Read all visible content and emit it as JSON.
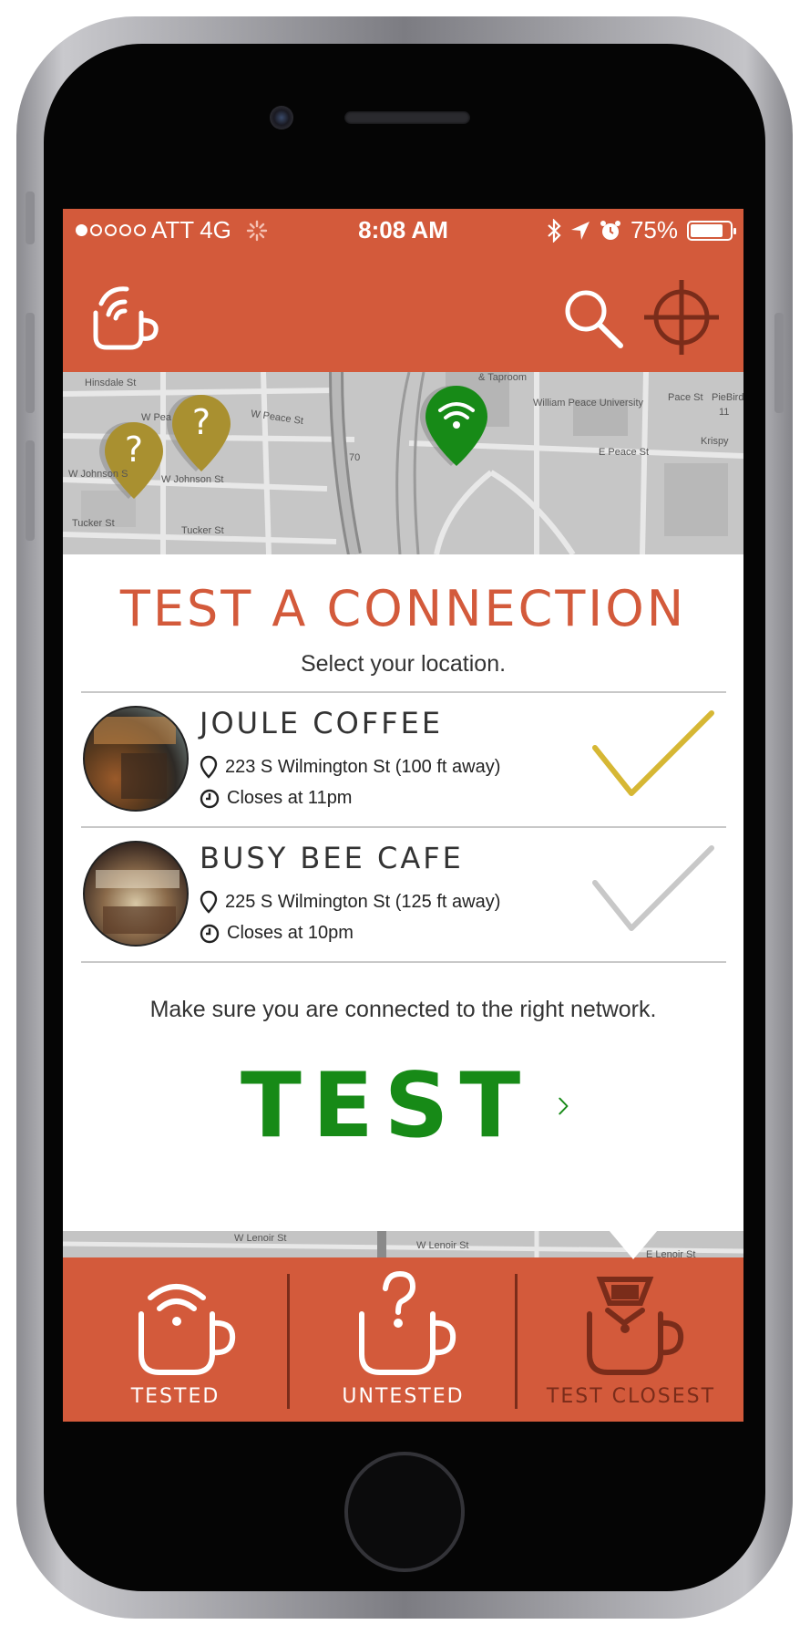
{
  "status_bar": {
    "signal_dots_filled": 1,
    "signal_dots_total": 5,
    "carrier": "ATT",
    "network": "4G",
    "time": "8:08 AM",
    "battery_percent": "75%",
    "battery_level": 0.75
  },
  "nav_bar": {
    "logo_icon": "wifi-coffee-cup-icon",
    "search_icon": "search-icon",
    "locate_icon": "crosshair-icon"
  },
  "map": {
    "labels": [
      "Hinsdale St",
      "W Peace St",
      "W Pea",
      "W Johnson St",
      "W Johnson S",
      "Tucker St",
      "Tucker St",
      "& Taproom",
      "William Peace University",
      "Pace St",
      "PieBird",
      "E Peace St",
      "Krispy",
      "70",
      "11"
    ],
    "pins": [
      {
        "type": "untested",
        "icon": "question-icon",
        "color": "#a99030"
      },
      {
        "type": "untested",
        "icon": "question-icon",
        "color": "#a99030"
      },
      {
        "type": "tested",
        "icon": "wifi-icon",
        "color": "#178a17"
      }
    ],
    "bottom_labels": [
      "W Lenoir St",
      "W Lenoir St",
      "E Lenoir St"
    ]
  },
  "panel": {
    "title": "TEST A CONNECTION",
    "subtitle": "Select your location.",
    "locations": [
      {
        "name": "JOULE COFFEE",
        "address": "223 S Wilmington St (100 ft away)",
        "hours": "Closes at 11pm",
        "selected": true,
        "check_color": "#d6b734"
      },
      {
        "name": "BUSY BEE CAFE",
        "address": "225 S Wilmington St (125 ft away)",
        "hours": "Closes at 10pm",
        "selected": false,
        "check_color": "#c8c8c8"
      }
    ],
    "note": "Make sure you are connected to the right network.",
    "test_button": "TEST"
  },
  "tab_bar": {
    "tabs": [
      {
        "label": "TESTED",
        "icon": "wifi-cup-icon",
        "active": false
      },
      {
        "label": "UNTESTED",
        "icon": "question-cup-icon",
        "active": false
      },
      {
        "label": "TEST CLOSEST",
        "icon": "cup-test-icon",
        "active": true
      }
    ]
  },
  "colors": {
    "brand": "#d35a3b",
    "test_green": "#178a17",
    "selected_check": "#d6b734",
    "unselected_check": "#c8c8c8",
    "untested_pin": "#a99030"
  }
}
